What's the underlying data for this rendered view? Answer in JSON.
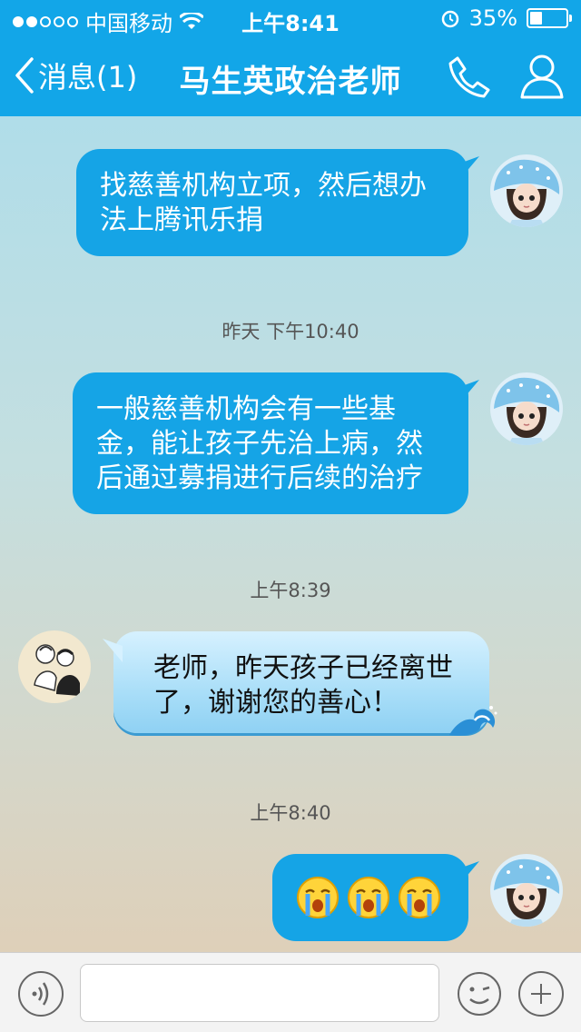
{
  "status_bar": {
    "carrier": "中国移动",
    "time": "上午8:41",
    "battery": "35%",
    "battery_level": 0.35
  },
  "nav": {
    "back_label": "消息(1)",
    "title": "马生英政治老师",
    "accent_color": "#12a6e8"
  },
  "messages": [
    {
      "direction": "outgoing",
      "text_lines": [
        "找慈善机构立项，然后想办",
        "法上腾讯乐捐"
      ]
    },
    {
      "timestamp": "昨天 下午10:40"
    },
    {
      "direction": "outgoing",
      "text_lines": [
        "一般慈善机构会有一些基",
        "金，能让孩子先治上病，然",
        "后通过募捐进行后续的治疗"
      ]
    },
    {
      "timestamp": "上午8:39"
    },
    {
      "direction": "incoming",
      "text_lines": [
        "老师，昨天孩子已经离世",
        "了，谢谢您的善心！"
      ]
    },
    {
      "timestamp": "上午8:40"
    },
    {
      "direction": "outgoing",
      "emojis": [
        "crying-face-icon",
        "crying-face-icon",
        "crying-face-icon"
      ]
    }
  ],
  "input_bar": {
    "placeholder": ""
  }
}
